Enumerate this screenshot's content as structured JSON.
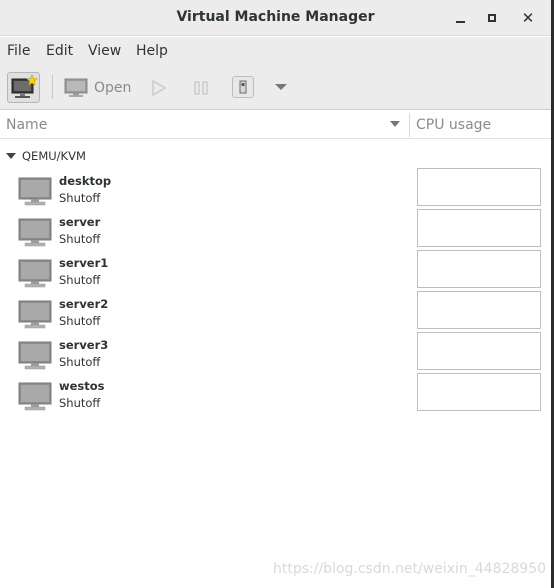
{
  "window": {
    "title": "Virtual Machine Manager"
  },
  "menubar": {
    "items": [
      "File",
      "Edit",
      "View",
      "Help"
    ]
  },
  "toolbar": {
    "open_label": "Open"
  },
  "columns": {
    "name": "Name",
    "cpu": "CPU usage"
  },
  "connection": {
    "label": "QEMU/KVM",
    "vms": [
      {
        "name": "desktop",
        "status": "Shutoff"
      },
      {
        "name": "server",
        "status": "Shutoff"
      },
      {
        "name": "server1",
        "status": "Shutoff"
      },
      {
        "name": "server2",
        "status": "Shutoff"
      },
      {
        "name": "server3",
        "status": "Shutoff"
      },
      {
        "name": "westos",
        "status": "Shutoff"
      }
    ]
  },
  "watermark": "https://blog.csdn.net/weixin_44828950"
}
